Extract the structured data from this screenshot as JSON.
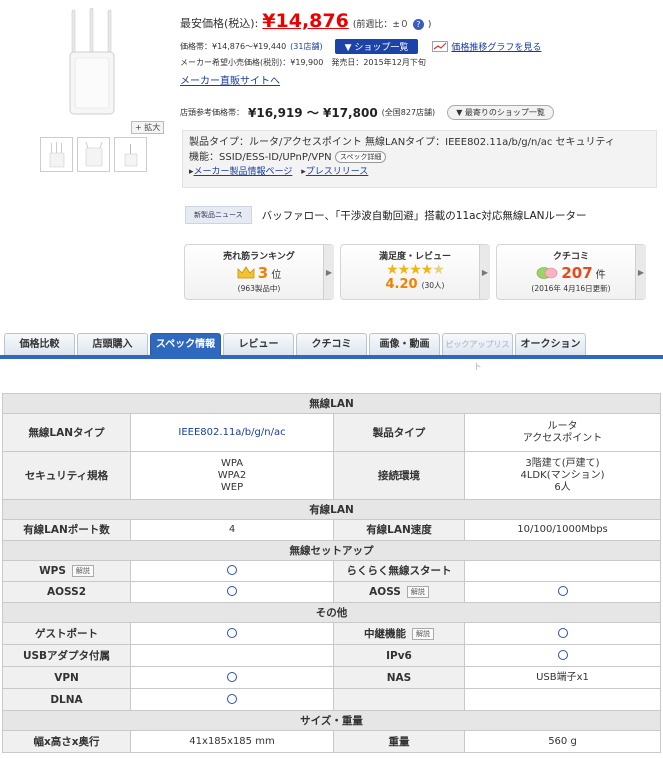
{
  "price": {
    "label": "最安価格(税込):",
    "value": "¥14,876",
    "change": "(前週比：±０",
    "help_icon": "question-icon",
    "change_close": ")"
  },
  "range": {
    "label": "価格帯：¥14,876〜¥19,440",
    "stores": "(31店舗)",
    "shop_list_button": "▼ ショップ一覧",
    "graph_link": "価格推移グラフを見る"
  },
  "maker": {
    "info": "メーカー希望小売価格(税別)：¥19,900　発売日：2015年12月下旬",
    "direct_link": "メーカー直販サイトへ"
  },
  "store_price": {
    "label": "店頭参考価格帯：",
    "value": "¥16,919 〜 ¥17,800",
    "count": "(全国827店舗)",
    "nearest_button": "▼ 最寄りのショップ一覧"
  },
  "image": {
    "zoom_label": "+ 拡大"
  },
  "summary": {
    "line1": "製品タイプ：ルータ/アクセスポイント 無線LANタイプ：IEEE802.11a/b/g/n/ac セキュリティ",
    "line2": "機能：SSID/ESS-ID/UPnP/VPN",
    "detail_button": "スペック詳細",
    "maker_link": "メーカー製品情報ページ",
    "press_link": "プレスリリース"
  },
  "news": {
    "tag": "新製品ニュース",
    "headline": "バッファロー、「干渉波自動回避」搭載の11ac対応無線LANルーター"
  },
  "stats": {
    "ranking": {
      "title": "売れ筋ランキング",
      "value": "3",
      "unit": "位",
      "sub": "(963製品中)"
    },
    "rating": {
      "title": "満足度・レビュー",
      "value": "4.20",
      "sub": "(30人)",
      "stars": 4
    },
    "review": {
      "title": "クチコミ",
      "value": "207",
      "unit": "件",
      "sub": "(2016年 4月16日更新)"
    }
  },
  "tabs": [
    "価格比較",
    "店頭購入",
    "スペック情報",
    "レビュー",
    "クチコミ",
    "画像・動画",
    "ピックアップリスト",
    "オークション"
  ],
  "spec_table": {
    "wireless_lan": "無線LAN",
    "wlan_type_label": "無線LANタイプ",
    "wlan_type_value": "IEEE802.11a/b/g/n/ac",
    "product_type_label": "製品タイプ",
    "product_type_value1": "ルータ",
    "product_type_value2": "アクセスポイント",
    "security_label": "セキュリティ規格",
    "security_value1": "WPA",
    "security_value2": "WPA2",
    "security_value3": "WEP",
    "env_label": "接続環境",
    "env_value1": "3階建て(戸建て)",
    "env_value2": "4LDK(マンション)",
    "env_value3": "6人",
    "wired_lan": "有線LAN",
    "wired_ports_label": "有線LANポート数",
    "wired_ports_value": "4",
    "wired_speed_label": "有線LAN速度",
    "wired_speed_value": "10/100/1000Mbps",
    "wireless_setup": "無線セットアップ",
    "wps_label": "WPS",
    "kaisetsu": "解説",
    "rakuraku_label": "らくらく無線スタート",
    "aoss2_label": "AOSS2",
    "aoss_label": "AOSS",
    "other": "その他",
    "guest_label": "ゲストポート",
    "relay_label": "中継機能",
    "usb_label": "USBアダプタ付属",
    "ipv6_label": "IPv6",
    "vpn_label": "VPN",
    "nas_label": "NAS",
    "nas_value": "USB端子x1",
    "dlna_label": "DLNA",
    "size_weight": "サイズ・重量",
    "size_label": "幅x高さx奥行",
    "size_value": "41x185x185 mm",
    "weight_label": "重量",
    "weight_value": "560 g"
  },
  "colors": {
    "price_red": "#ee0000",
    "tab_active": "#2f68bf",
    "link_blue": "#1a3d9c",
    "rating_orange": "#f08200"
  }
}
